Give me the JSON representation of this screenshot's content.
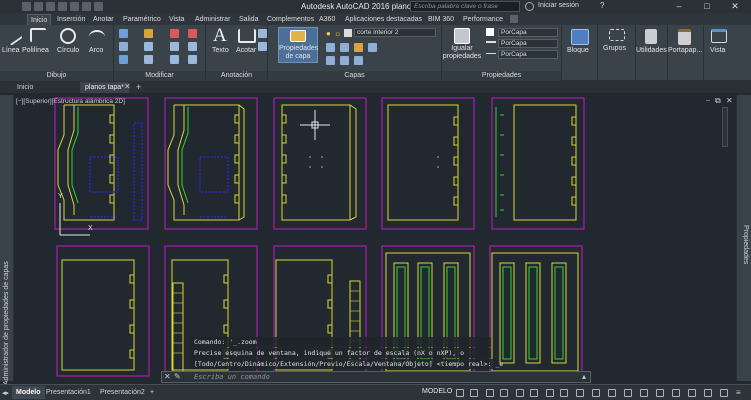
{
  "app": {
    "title": "Autodesk AutoCAD 2016    planos tapa.dwg",
    "logo_letter": "A",
    "search_placeholder": "Escriba palabra clave o frase",
    "login": "Iniciar sesión",
    "help": "?"
  },
  "ribbon_tabs": [
    "Inicio",
    "Inserción",
    "Anotar",
    "Paramétrico",
    "Vista",
    "Administrar",
    "Salida",
    "Complementos",
    "A360",
    "Aplicaciones destacadas",
    "BIM 360",
    "Performance"
  ],
  "draw_tools": {
    "line": "Línea",
    "polyline": "Polilínea",
    "circle": "Círculo",
    "arc": "Arco"
  },
  "annotate_tools": {
    "text": "Texto",
    "dimension": "Acotar"
  },
  "layer_tools": {
    "layer_props": "Propiedades de capa",
    "layer_name": "corte interior 2"
  },
  "props_tools": {
    "match": "Igualar propiedades",
    "bylayer1": "PorCapa",
    "bylayer2": "PorCapa",
    "bylayer3": "PorCapa"
  },
  "big_buttons": {
    "block": "Bloque",
    "groups": "Grupos",
    "utilities": "Utilidades",
    "clipboard": "Portapap...",
    "view": "Vista"
  },
  "panel_labels": {
    "draw": "Dibujo",
    "modify": "Modificar",
    "annotation": "Anotación",
    "layers": "Capas",
    "properties": "Propiedades"
  },
  "file_tabs": {
    "start": "Inicio",
    "drawing": "planos tapa*"
  },
  "viewport_label": "[−][Superior][Estructura alámbrica 2D]",
  "left_palette": "Administrador de propiedades de capas",
  "right_palette": "Propiedades",
  "ucs": {
    "x": "X",
    "y": "Y"
  },
  "command": {
    "history": [
      "Comando:  '_.zoom",
      "Precise esquina de ventana, indique un factor de escala (nX o nXP), o",
      "[Todo/Centro/Dinámico/Extensión/Previo/Escala/Ventana/Objeto] <tiempo real>: _e"
    ],
    "placeholder": "Escriba un comando"
  },
  "status": {
    "model_tab": "Modelo",
    "layout1": "Presentación1",
    "layout2": "Presentación2",
    "add": "+",
    "mode": "MODELO"
  },
  "colors": {
    "drawing_bg": "#212830",
    "sheet_border": "#c31dc3",
    "geometry": "#d8d830",
    "blue": "#2a2ae6",
    "green": "#2fd62f",
    "ribbon": "#3a424a"
  }
}
